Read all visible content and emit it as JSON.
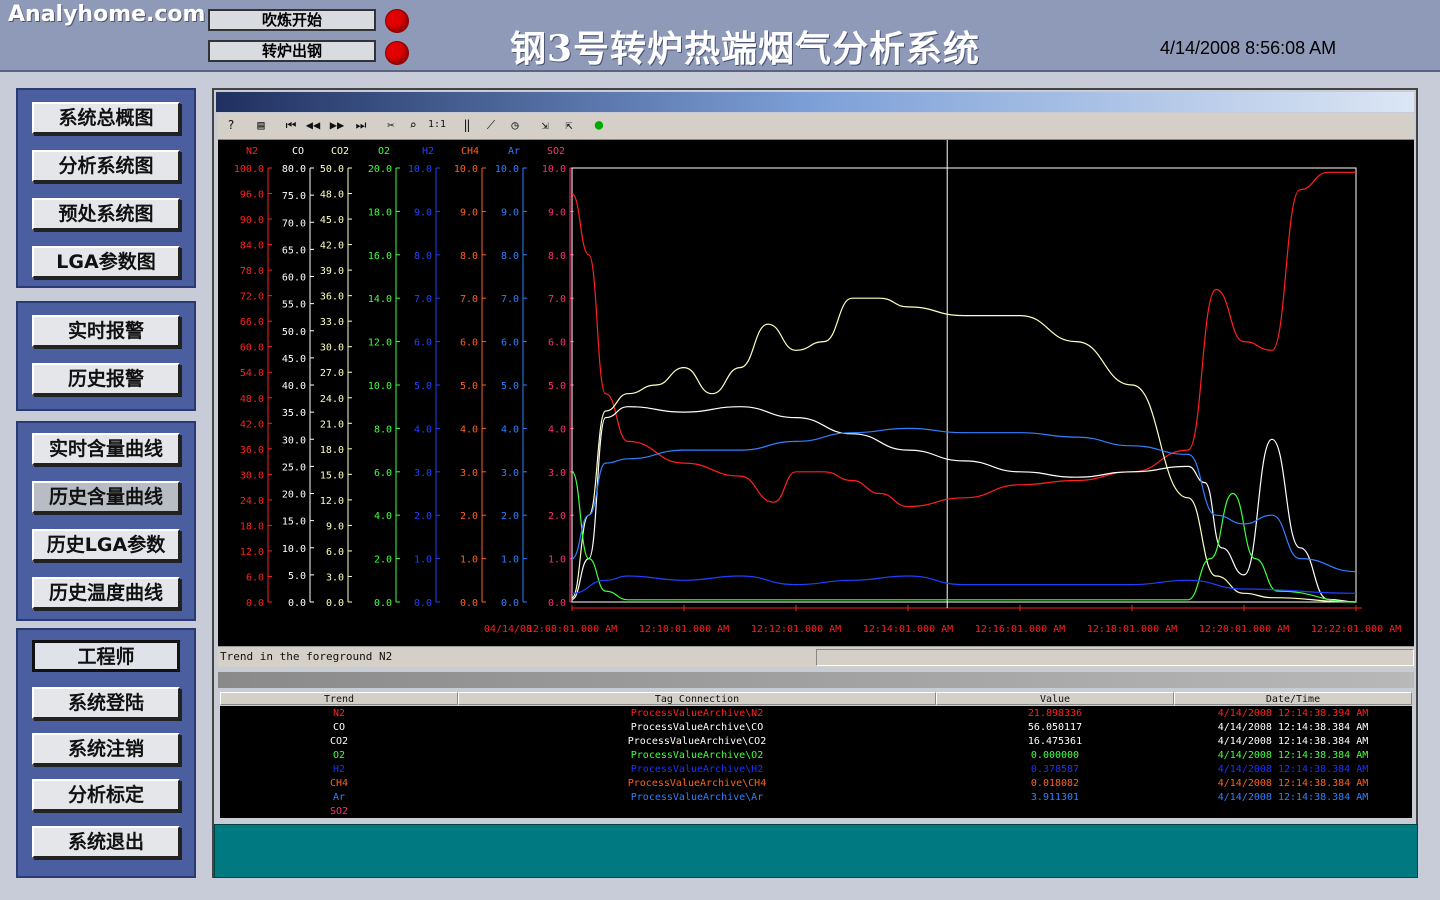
{
  "header": {
    "logo": "Analyhome.com",
    "btn_blow_start": "吹炼开始",
    "btn_tap": "转炉出钢",
    "title": "钢3号转炉热端烟气分析系统",
    "datetime": "4/14/2008 8:56:08 AM",
    "led_color": "#e00000"
  },
  "nav": {
    "group1": [
      "系统总概图",
      "分析系统图",
      "预处系统图",
      "LGA参数图"
    ],
    "group2": [
      "实时报警",
      "历史报警"
    ],
    "group3": [
      "实时含量曲线",
      "历史含量曲线",
      "历史LGA参数",
      "历史温度曲线"
    ],
    "group3_selected": "历史含量曲线",
    "group4_header": "工程师",
    "group4": [
      "系统登陆",
      "系统注销",
      "分析标定",
      "系统退出"
    ]
  },
  "toolbar": {
    "icons": [
      "help-icon",
      "table-icon",
      "first-icon",
      "prev-icon",
      "next-icon",
      "last-icon",
      "ruler-icon",
      "zoom-icon",
      "one-to-one-icon",
      "bars-icon",
      "trend-icon",
      "clock-icon",
      "export-icon",
      "export2-icon",
      "status-icon"
    ]
  },
  "status_text": "Trend in the foreground  N2",
  "chart_data": {
    "type": "line",
    "x": [
      "04/14/08",
      "12:08:01.000 AM",
      "12:10:01.000 AM",
      "12:12:01.000 AM",
      "12:14:01.000 AM",
      "12:16:01.000 AM",
      "12:18:01.000 AM",
      "12:20:01.000 AM",
      "12:22:01.000 AM"
    ],
    "x_range_minutes": [
      0,
      14
    ],
    "cursor_minute": 6.7,
    "axes": [
      {
        "name": "N2",
        "color": "#ff2020",
        "ticks": [
          "100.0",
          "96.0",
          "90.0",
          "84.0",
          "78.0",
          "72.0",
          "66.0",
          "60.0",
          "54.0",
          "48.0",
          "42.0",
          "36.0",
          "30.0",
          "24.0",
          "18.0",
          "12.0",
          "6.0",
          "0.0"
        ],
        "range": [
          0,
          100
        ]
      },
      {
        "name": "CO",
        "color": "#ffffff",
        "ticks": [
          "80.0",
          "75.0",
          "70.0",
          "65.0",
          "60.0",
          "55.0",
          "50.0",
          "45.0",
          "40.0",
          "35.0",
          "30.0",
          "25.0",
          "20.0",
          "15.0",
          "10.0",
          "5.0",
          "0.0"
        ],
        "range": [
          0,
          80
        ]
      },
      {
        "name": "CO2",
        "color": "#ffffc0",
        "ticks": [
          "50.0",
          "48.0",
          "45.0",
          "42.0",
          "39.0",
          "36.0",
          "33.0",
          "30.0",
          "27.0",
          "24.0",
          "21.0",
          "18.0",
          "15.0",
          "12.0",
          "9.0",
          "6.0",
          "3.0",
          "0.0"
        ],
        "range": [
          0,
          50
        ]
      },
      {
        "name": "O2",
        "color": "#40ff40",
        "ticks": [
          "20.0",
          "18.0",
          "16.0",
          "14.0",
          "12.0",
          "10.0",
          "8.0",
          "6.0",
          "4.0",
          "2.0",
          "0.0"
        ],
        "range": [
          0,
          20
        ]
      },
      {
        "name": "H2",
        "color": "#2040ff",
        "ticks": [
          "10.0",
          "9.0",
          "8.0",
          "7.0",
          "6.0",
          "5.0",
          "4.0",
          "3.0",
          "2.0",
          "1.0",
          "0.0"
        ],
        "range": [
          0,
          10
        ]
      },
      {
        "name": "CH4",
        "color": "#ff6020",
        "ticks": [
          "10.0",
          "9.0",
          "8.0",
          "7.0",
          "6.0",
          "5.0",
          "4.0",
          "3.0",
          "2.0",
          "1.0",
          "0.0"
        ],
        "range": [
          0,
          10
        ]
      },
      {
        "name": "Ar",
        "color": "#3080ff",
        "ticks": [
          "10.0",
          "9.0",
          "8.0",
          "7.0",
          "6.0",
          "5.0",
          "4.0",
          "3.0",
          "2.0",
          "1.0",
          "0.0"
        ],
        "range": [
          0,
          10
        ]
      },
      {
        "name": "SO2",
        "color": "#ff3070",
        "ticks": [
          "10.0",
          "9.0",
          "8.0",
          "7.0",
          "6.0",
          "5.0",
          "4.0",
          "3.0",
          "2.0",
          "1.0",
          "0.0"
        ],
        "range": [
          0,
          10
        ]
      }
    ],
    "series": [
      {
        "name": "N2",
        "color": "#ff2020",
        "range": [
          0,
          100
        ],
        "points": [
          [
            0,
            94
          ],
          [
            0.3,
            80
          ],
          [
            0.6,
            48
          ],
          [
            1,
            37
          ],
          [
            2,
            32
          ],
          [
            3,
            29
          ],
          [
            3.6,
            23
          ],
          [
            4,
            30
          ],
          [
            4.5,
            30
          ],
          [
            5,
            28
          ],
          [
            5.5,
            25
          ],
          [
            6,
            22
          ],
          [
            7,
            24
          ],
          [
            8,
            27
          ],
          [
            9,
            28
          ],
          [
            10,
            30
          ],
          [
            11,
            35
          ],
          [
            11.5,
            72
          ],
          [
            12,
            60
          ],
          [
            12.5,
            58
          ],
          [
            13,
            95
          ],
          [
            13.5,
            99
          ],
          [
            14,
            99
          ]
        ]
      },
      {
        "name": "CO",
        "color": "#ffffff",
        "range": [
          0,
          80
        ],
        "points": [
          [
            0,
            0.5
          ],
          [
            0.3,
            8
          ],
          [
            0.6,
            34
          ],
          [
            1,
            36
          ],
          [
            2,
            35
          ],
          [
            3,
            36
          ],
          [
            4,
            34
          ],
          [
            5,
            31
          ],
          [
            6,
            28
          ],
          [
            7,
            26
          ],
          [
            8,
            24
          ],
          [
            9,
            23
          ],
          [
            10,
            24
          ],
          [
            11,
            25
          ],
          [
            11.3,
            22
          ],
          [
            11.6,
            10
          ],
          [
            12,
            5
          ],
          [
            12.5,
            30
          ],
          [
            13,
            10
          ],
          [
            13.5,
            0.5
          ],
          [
            14,
            0
          ]
        ]
      },
      {
        "name": "CO2",
        "color": "#ffffc0",
        "range": [
          0,
          50
        ],
        "points": [
          [
            0,
            0.5
          ],
          [
            0.3,
            10
          ],
          [
            0.6,
            22
          ],
          [
            1,
            24
          ],
          [
            1.5,
            25
          ],
          [
            2,
            27
          ],
          [
            2.5,
            24
          ],
          [
            3,
            27
          ],
          [
            3.5,
            32
          ],
          [
            4,
            29
          ],
          [
            4.5,
            30
          ],
          [
            5,
            35
          ],
          [
            5.5,
            35
          ],
          [
            6,
            34
          ],
          [
            7,
            33
          ],
          [
            8,
            33
          ],
          [
            9,
            30
          ],
          [
            10,
            25
          ],
          [
            11,
            12
          ],
          [
            11.5,
            3
          ],
          [
            12,
            1
          ],
          [
            12.5,
            0.5
          ],
          [
            14,
            0
          ]
        ]
      },
      {
        "name": "O2",
        "color": "#40ff40",
        "range": [
          0,
          20
        ],
        "points": [
          [
            0,
            6
          ],
          [
            0.3,
            2
          ],
          [
            0.6,
            0.5
          ],
          [
            1,
            0.1
          ],
          [
            11,
            0.1
          ],
          [
            11.4,
            2
          ],
          [
            11.8,
            5
          ],
          [
            12.2,
            2
          ],
          [
            12.6,
            0.5
          ],
          [
            14,
            0
          ]
        ]
      },
      {
        "name": "H2",
        "color": "#2040ff",
        "range": [
          0,
          10
        ],
        "points": [
          [
            0,
            0.2
          ],
          [
            0.6,
            0.5
          ],
          [
            1,
            0.6
          ],
          [
            2,
            0.5
          ],
          [
            3,
            0.6
          ],
          [
            4,
            0.4
          ],
          [
            5,
            0.5
          ],
          [
            6,
            0.6
          ],
          [
            7,
            0.4
          ],
          [
            8,
            0.4
          ],
          [
            9,
            0.4
          ],
          [
            10,
            0.4
          ],
          [
            11,
            0.5
          ],
          [
            12,
            0.3
          ],
          [
            14,
            0.2
          ]
        ]
      },
      {
        "name": "Ar",
        "color": "#3080ff",
        "range": [
          0,
          10
        ],
        "points": [
          [
            0,
            1
          ],
          [
            0.3,
            2
          ],
          [
            0.6,
            3.2
          ],
          [
            1,
            3.3
          ],
          [
            2,
            3.5
          ],
          [
            3,
            3.5
          ],
          [
            4,
            3.7
          ],
          [
            5,
            3.9
          ],
          [
            6,
            4
          ],
          [
            7,
            3.9
          ],
          [
            8,
            3.9
          ],
          [
            9,
            3.8
          ],
          [
            10,
            3.6
          ],
          [
            11,
            3.4
          ],
          [
            11.5,
            2
          ],
          [
            12,
            1.8
          ],
          [
            12.5,
            2
          ],
          [
            13,
            1
          ],
          [
            14,
            0.7
          ]
        ]
      }
    ]
  },
  "table": {
    "headers": [
      "Trend",
      "Tag Connection",
      "Value",
      "Date/Time"
    ],
    "rows": [
      {
        "trend": "N2",
        "tag": "ProcessValueArchive\\N2",
        "value": "21.898336",
        "time": "4/14/2008 12:14:38.394 AM",
        "color": "#ff2020"
      },
      {
        "trend": "CO",
        "tag": "ProcessValueArchive\\CO",
        "value": "56.050117",
        "time": "4/14/2008 12:14:38.384 AM",
        "color": "#ffffff"
      },
      {
        "trend": "CO2",
        "tag": "ProcessValueArchive\\CO2",
        "value": "16.475361",
        "time": "4/14/2008 12:14:38.384 AM",
        "color": "#ffffff"
      },
      {
        "trend": "O2",
        "tag": "ProcessValueArchive\\O2",
        "value": "0.000000",
        "time": "4/14/2008 12:14:38.384 AM",
        "color": "#40ff40"
      },
      {
        "trend": "H2",
        "tag": "ProcessValueArchive\\H2",
        "value": "0.378587",
        "time": "4/14/2008 12:14:38.384 AM",
        "color": "#2030ff"
      },
      {
        "trend": "CH4",
        "tag": "ProcessValueArchive\\CH4",
        "value": "0.018082",
        "time": "4/14/2008 12:14:38.384 AM",
        "color": "#ff6020"
      },
      {
        "trend": "Ar",
        "tag": "ProcessValueArchive\\Ar",
        "value": "3.911301",
        "time": "4/14/2008 12:14:38.384 AM",
        "color": "#3080ff"
      },
      {
        "trend": "SO2",
        "tag": "",
        "value": "",
        "time": "",
        "color": "#ff3070"
      }
    ]
  }
}
